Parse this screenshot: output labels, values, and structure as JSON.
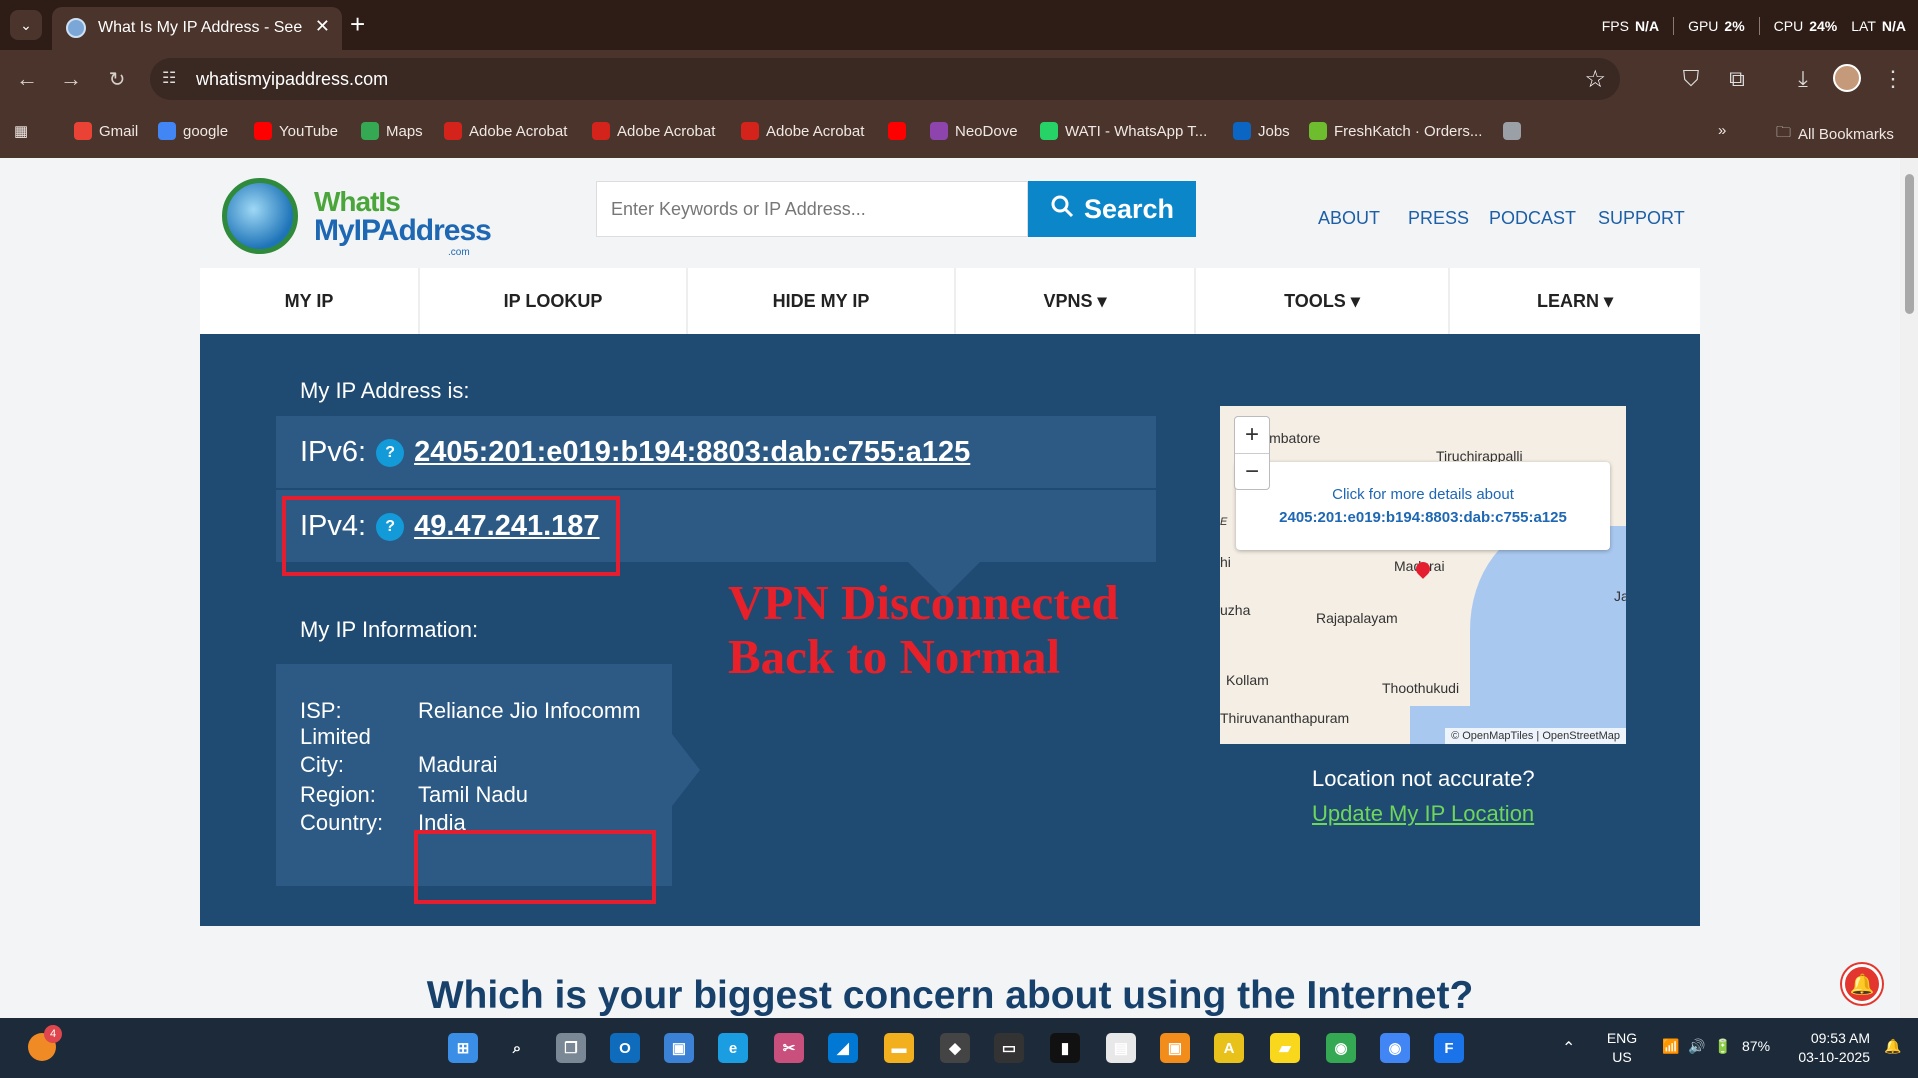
{
  "browser": {
    "tab_title": "What Is My IP Address - See Your",
    "url": "whatismyipaddress.com",
    "perf": {
      "fps_label": "FPS",
      "fps": "N/A",
      "gpu_label": "GPU",
      "gpu": "2%",
      "cpu_label": "CPU",
      "cpu": "24%",
      "lat_label": "LAT",
      "lat": "N/A"
    },
    "bookmarks": [
      {
        "label": "Gmail",
        "icon": "gmail-icon",
        "color": "#ea4335"
      },
      {
        "label": "google",
        "icon": "google-icon",
        "color": "#4285f4"
      },
      {
        "label": "YouTube",
        "icon": "youtube-icon",
        "color": "#ff0000"
      },
      {
        "label": "Maps",
        "icon": "maps-icon",
        "color": "#34a853"
      },
      {
        "label": "Adobe Acrobat",
        "icon": "acrobat-icon",
        "color": "#d4231b"
      },
      {
        "label": "Adobe Acrobat",
        "icon": "acrobat-icon",
        "color": "#d4231b"
      },
      {
        "label": "Adobe Acrobat",
        "icon": "acrobat-icon",
        "color": "#d4231b"
      },
      {
        "label": "",
        "icon": "youtube-icon",
        "color": "#ff0000"
      },
      {
        "label": "NeoDove",
        "icon": "neodove-icon",
        "color": "#8e44ad"
      },
      {
        "label": "WATI - WhatsApp T...",
        "icon": "wati-icon",
        "color": "#25d366"
      },
      {
        "label": "Jobs",
        "icon": "linkedin-icon",
        "color": "#0a66c2"
      },
      {
        "label": "FreshKatch · Orders...",
        "icon": "freshkatch-icon",
        "color": "#6dbd2e"
      },
      {
        "label": "",
        "icon": "globe-icon",
        "color": "#9aa0a6"
      }
    ],
    "all_bookmarks": "All Bookmarks"
  },
  "site": {
    "logo": {
      "line1": "WhatIs",
      "line2": "MyIPAddress",
      "line3": ".com"
    },
    "search_placeholder": "Enter Keywords or IP Address...",
    "search_button": "Search",
    "top_links": [
      "ABOUT",
      "PRESS",
      "PODCAST",
      "SUPPORT"
    ],
    "nav": [
      "MY IP",
      "IP LOOKUP",
      "HIDE MY IP",
      "VPNS ▾",
      "TOOLS ▾",
      "LEARN ▾"
    ],
    "my_ip_label": "My IP Address is:",
    "ipv6_label": "IPv6:",
    "ipv6": "2405:201:e019:b194:8803:dab:c755:a125",
    "ipv4_label": "IPv4:",
    "ipv4": "49.47.241.187",
    "help_q": "?",
    "info_label": "My IP Information:",
    "info": {
      "isp_label": "ISP:",
      "isp": "Reliance Jio Infocomm",
      "isp_cont": "Limited",
      "city_label": "City:",
      "city": "Madurai",
      "region_label": "Region:",
      "region": "Tamil Nadu",
      "country_label": "Country:",
      "country": "India"
    },
    "annotation": [
      "VPN Disconnected",
      "Back to Normal"
    ],
    "map": {
      "popup_line1": "Click for more details about",
      "popup_line2": "2405:201:e019:b194:8803:dab:c755:a125",
      "places": [
        "imbatore",
        "Tiruchirappalli",
        "Madurai",
        "uzha",
        "Rajapalayam",
        "Kollam",
        "Thoothukudi",
        "Thiruvananthapuram",
        "E",
        "hi",
        "Ja"
      ],
      "attribution": "© OpenMapTiles | OpenStreetMap"
    },
    "location_question": "Location not accurate?",
    "location_update": "Update My IP Location",
    "concern_heading": "Which is your biggest concern about using the Internet?",
    "notification_glyph": "🔔"
  },
  "taskbar": {
    "weather_badge": "4",
    "lang1": "ENG",
    "lang2": "US",
    "battery": "87%",
    "time": "09:53 AM",
    "date": "03-10-2025"
  }
}
